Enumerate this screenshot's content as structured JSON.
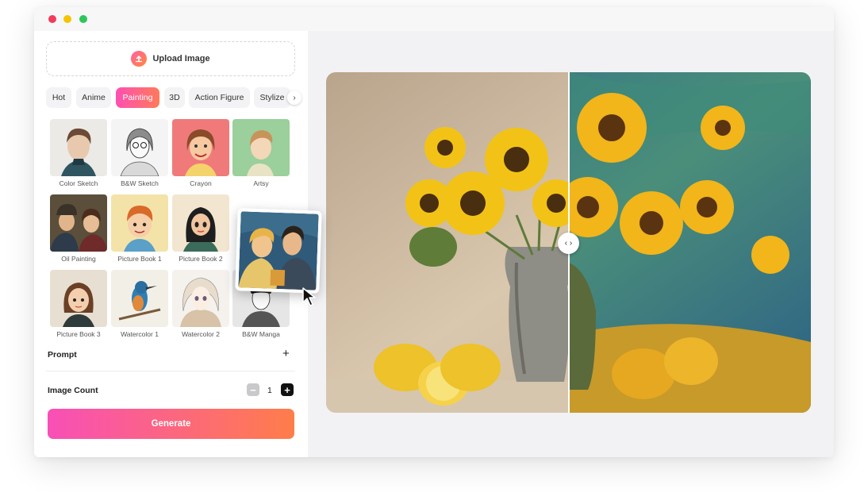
{
  "window": {
    "controls": [
      "close",
      "minimize",
      "maximize"
    ]
  },
  "sidebar": {
    "upload": {
      "label": "Upload Image",
      "icon": "upload-icon"
    },
    "tabs": [
      {
        "label": "Hot",
        "active": false
      },
      {
        "label": "Anime",
        "active": false
      },
      {
        "label": "Painting",
        "active": true
      },
      {
        "label": "3D",
        "active": false
      },
      {
        "label": "Action Figure",
        "active": false
      },
      {
        "label": "Stylize",
        "active": false
      }
    ],
    "styles": [
      {
        "label": "Color Sketch"
      },
      {
        "label": "B&W Sketch"
      },
      {
        "label": "Crayon"
      },
      {
        "label": "Artsy"
      },
      {
        "label": "Oil Painting"
      },
      {
        "label": "Picture Book 1"
      },
      {
        "label": "Picture Book 2"
      },
      {
        "label": "Picture Book 3"
      },
      {
        "label": "Watercolor 1"
      },
      {
        "label": "Watercolor 2"
      },
      {
        "label": "B&W Manga"
      }
    ],
    "prompt": {
      "label": "Prompt"
    },
    "image_count": {
      "label": "Image Count",
      "value": "1"
    },
    "generate": {
      "label": "Generate"
    }
  },
  "preview": {
    "handle_icon": "chevron-left-right-icon"
  },
  "colors": {
    "accent_start": "#ff4fb2",
    "accent_end": "#ff7a4a"
  }
}
